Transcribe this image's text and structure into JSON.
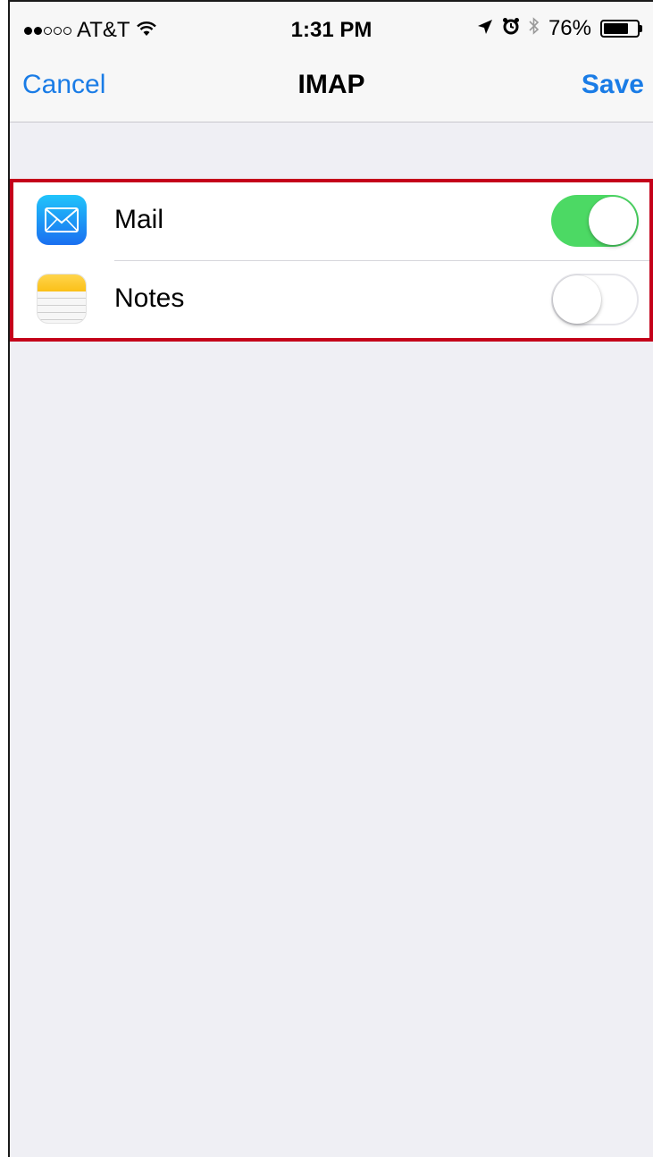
{
  "status_bar": {
    "carrier": "AT&T",
    "signal_bars_filled": 2,
    "signal_bars_total": 5,
    "time": "1:31 PM",
    "battery_percent_label": "76%",
    "battery_level": 0.76,
    "icons": [
      "wifi-icon",
      "location-arrow-icon",
      "alarm-clock-icon",
      "bluetooth-icon",
      "battery-icon"
    ]
  },
  "nav": {
    "cancel_label": "Cancel",
    "title": "IMAP",
    "save_label": "Save"
  },
  "list": {
    "highlight_color": "#c4001a",
    "items": [
      {
        "label": "Mail",
        "icon": "mail-app-icon",
        "enabled": true
      },
      {
        "label": "Notes",
        "icon": "notes-app-icon",
        "enabled": false
      }
    ]
  },
  "colors": {
    "accent": "#1a7ce6",
    "toggle_on": "#4cd964",
    "background": "#efeff4"
  }
}
